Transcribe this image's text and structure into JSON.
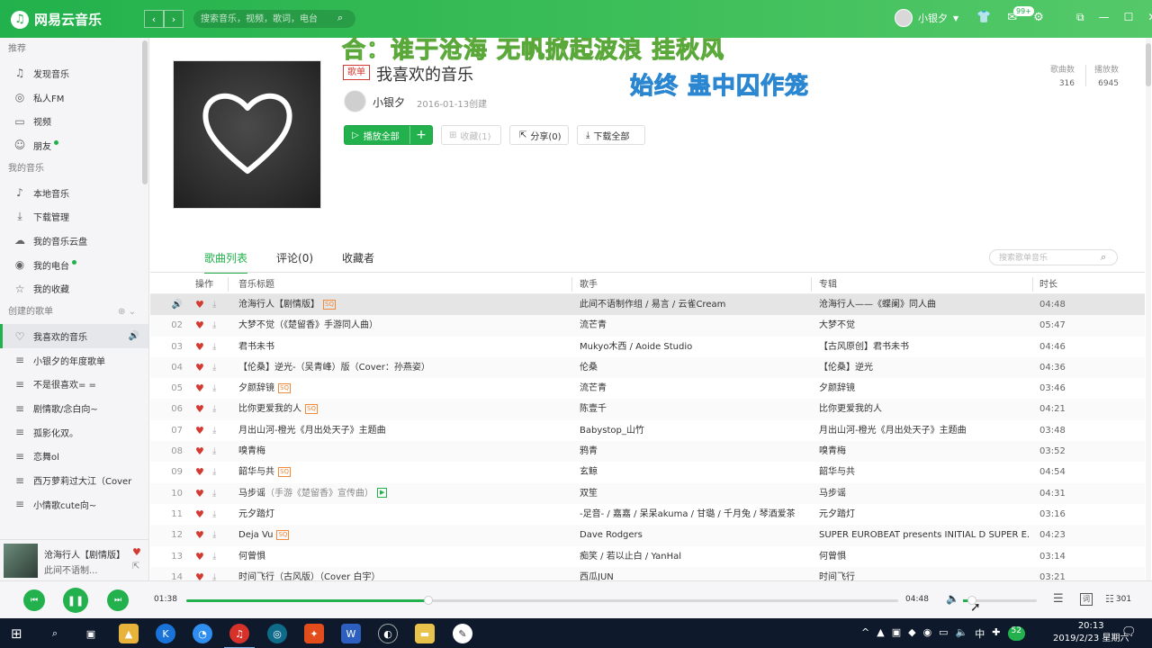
{
  "app": {
    "logo_text": "网易云音乐",
    "search_placeholder": "搜索音乐，视频，歌词，电台",
    "user_name": "小银夕",
    "msg_badge": "99+"
  },
  "lyrics": {
    "line1": "合：谁于沧海 无帆掀起波浪 挂秋风",
    "line2": "始终 蛊中囚作笼"
  },
  "sidebar": {
    "sections": [
      {
        "title": "推荐",
        "items": [
          {
            "label": "发现音乐",
            "icon": "music-note-icon"
          },
          {
            "label": "私人FM",
            "icon": "radio-icon"
          },
          {
            "label": "视频",
            "icon": "video-icon"
          },
          {
            "label": "朋友",
            "icon": "friends-icon",
            "dot": true
          }
        ]
      },
      {
        "title": "我的音乐",
        "items": [
          {
            "label": "本地音乐",
            "icon": "local-music-icon"
          },
          {
            "label": "下载管理",
            "icon": "download-icon"
          },
          {
            "label": "我的音乐云盘",
            "icon": "cloud-icon"
          },
          {
            "label": "我的电台",
            "icon": "podcast-icon",
            "dot": true
          },
          {
            "label": "我的收藏",
            "icon": "collection-icon"
          }
        ]
      },
      {
        "title": "创建的歌单",
        "items": [
          {
            "label": "我喜欢的音乐",
            "icon": "heart-icon",
            "active": true
          },
          {
            "label": "小银夕的年度歌单",
            "icon": "playlist-icon"
          },
          {
            "label": "不是很喜欢= =",
            "icon": "playlist-icon"
          },
          {
            "label": "剧情歌/念白向~",
            "icon": "playlist-icon"
          },
          {
            "label": "孤影化双。",
            "icon": "playlist-icon"
          },
          {
            "label": "恋舞ol",
            "icon": "playlist-icon"
          },
          {
            "label": "西万萝莉过大江（Cover",
            "icon": "playlist-icon"
          },
          {
            "label": "小情歌cute向~",
            "icon": "playlist-icon"
          }
        ]
      }
    ]
  },
  "now_playing": {
    "title": "沧海行人【剧情版】",
    "artist": "此间不语制..."
  },
  "playlist": {
    "tag": "歌单",
    "title": "我喜欢的音乐",
    "creator": "小银夕",
    "created": "2016-01-13创建",
    "play_all": "播放全部",
    "collect": "收藏(1)",
    "share": "分享(0)",
    "download_all": "下载全部",
    "song_count_label": "歌曲数",
    "song_count": "316",
    "play_count_label": "播放数",
    "play_count": "6945"
  },
  "tabs": [
    "歌曲列表",
    "评论(0)",
    "收藏者"
  ],
  "list_search_placeholder": "搜索歌单音乐",
  "table": {
    "headers": {
      "ops": "操作",
      "title": "音乐标题",
      "artist": "歌手",
      "album": "专辑",
      "duration": "时长"
    },
    "rows": [
      {
        "num": "",
        "title": "沧海行人【剧情版】",
        "sq": true,
        "artist": "此间不语制作组 / 易言 / 云雀Cream",
        "album": "沧海行人——《蝶阑》同人曲",
        "dur": "04:48",
        "playing": true
      },
      {
        "num": "02",
        "title": "大梦不觉（《楚留香》手游同人曲）",
        "artist": "流芒青",
        "album": "大梦不觉",
        "dur": "05:47"
      },
      {
        "num": "03",
        "title": "君书未书",
        "artist": "Mukyo木西 / Aoide Studio",
        "album": "【古风原创】君书未书",
        "dur": "04:46"
      },
      {
        "num": "04",
        "title": "【伦桑】逆光-（吴青峰）版（Cover：孙燕姿）",
        "artist": "伦桑",
        "album": "【伦桑】逆光",
        "dur": "04:36"
      },
      {
        "num": "05",
        "title": "夕颜辞镜",
        "sq": true,
        "artist": "流芒青",
        "album": "夕颜辞镜",
        "dur": "03:46"
      },
      {
        "num": "06",
        "title": "比你更爱我的人",
        "sq": true,
        "artist": "陈壹千",
        "album": "比你更爱我的人",
        "dur": "04:21"
      },
      {
        "num": "07",
        "title": "月出山河-橙光《月出处天子》主题曲",
        "artist": "Babystop_山竹",
        "album": "月出山河-橙光《月出处天子》主题曲",
        "dur": "03:48"
      },
      {
        "num": "08",
        "title": "嗅青梅",
        "artist": "鸦青",
        "album": "嗅青梅",
        "dur": "03:52"
      },
      {
        "num": "09",
        "title": "韶华与共",
        "sq": true,
        "artist": "玄鲸",
        "album": "韶华与共",
        "dur": "04:54"
      },
      {
        "num": "10",
        "title": "马步谣",
        "sub": "（手游《楚留香》宣传曲）",
        "mv": true,
        "artist": "双笙",
        "album": "马步谣",
        "dur": "04:31"
      },
      {
        "num": "11",
        "title": "元夕踏灯",
        "artist": "-足音- / 嘉嘉 / 呆呆akuma / 甘璐 / 千月兔 / 琴酒爱茶",
        "album": "元夕踏灯",
        "dur": "03:16"
      },
      {
        "num": "12",
        "title": "Deja Vu",
        "sq": true,
        "artist": "Dave Rodgers",
        "album": "SUPER EUROBEAT presents INITIAL D SUPER E...",
        "dur": "04:23"
      },
      {
        "num": "13",
        "title": "何曾惧",
        "artist": "痴笑 / 若以止白 / YanHal",
        "album": "何曾惧",
        "dur": "03:14"
      },
      {
        "num": "14",
        "title": "时间飞行（古风版）（Cover 白宇）",
        "artist": "西瓜JUN",
        "album": "时间飞行",
        "dur": "03:21"
      }
    ]
  },
  "player": {
    "current": "01:38",
    "total": "04:48",
    "progress_fraction": 0.34,
    "volume_fraction": 0.12,
    "queue_count": "301",
    "lyric_btn": "词"
  },
  "taskbar": {
    "time": "20:13",
    "date": "2019/2/23 星期六",
    "ime": "中",
    "badge": "52"
  },
  "colors": {
    "accent": "#22b14c",
    "heart": "#d33a31",
    "sq": "#f08a3c"
  }
}
